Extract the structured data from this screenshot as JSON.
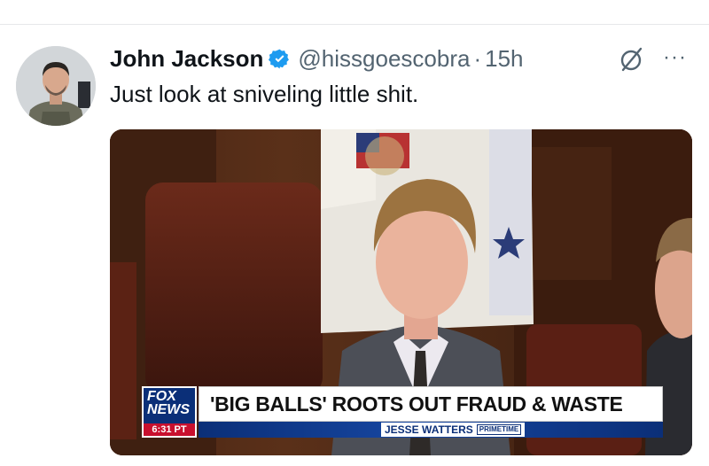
{
  "tweet": {
    "author": {
      "display_name": "John Jackson",
      "handle": "@hissgoescobra",
      "verified": true,
      "verified_color": "#1d9bf0",
      "avatar_icon": "profile-avatar"
    },
    "separator": "·",
    "time": "15h",
    "text": "Just look at sniveling little shit.",
    "actions": {
      "grok_icon": "grok-icon",
      "more_label": "···"
    },
    "media": {
      "overlay": {
        "network_logo_line1": "FOX",
        "network_logo_line2": "NEWS",
        "clock": "6:31 PT",
        "headline": "'BIG BALLS' ROOTS OUT FRAUD & WASTE",
        "show_name": "JESSE WATTERS",
        "show_tag": "PRIMETIME"
      }
    }
  },
  "colors": {
    "text_primary": "#0f1419",
    "text_secondary": "#536471",
    "fox_blue": "#0b2f78",
    "fox_red": "#c8102e"
  }
}
